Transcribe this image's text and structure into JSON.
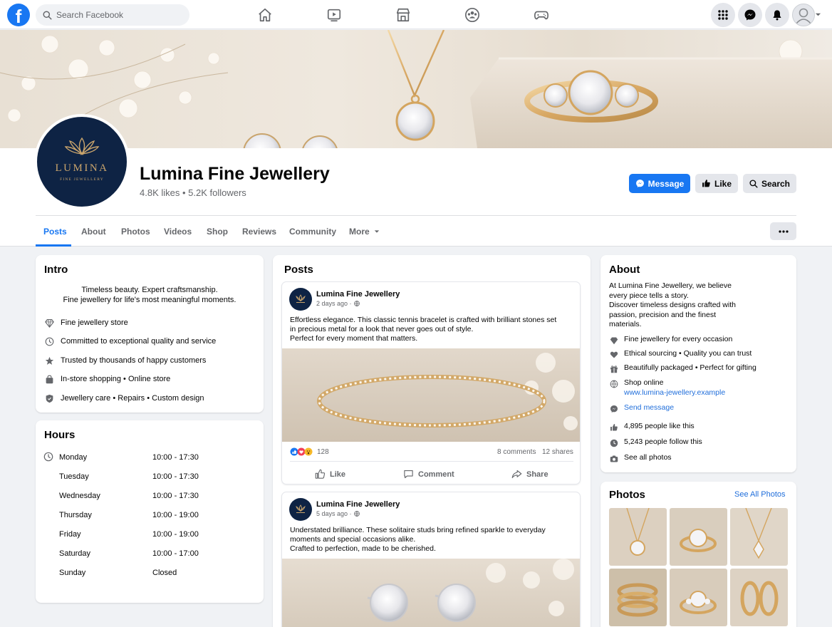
{
  "topbar": {
    "logo": "f",
    "search_placeholder": "Search Facebook",
    "nav_icons": [
      "home-icon",
      "watch-icon",
      "marketplace-icon",
      "groups-icon",
      "gaming-icon"
    ],
    "right_icons": [
      "menu-grid-icon",
      "messenger-icon",
      "notifications-icon",
      "account-avatar"
    ]
  },
  "page": {
    "name": "Lumina Fine Jewellery",
    "stats": "4.8K likes • 5.2K followers",
    "logo_text": "LUMINA",
    "logo_subtext": "FINE JEWELLERY",
    "buttons": {
      "message": "Message",
      "like": "Like",
      "search": "Search"
    },
    "accent": "#1877f2"
  },
  "tabs": [
    "Posts",
    "About",
    "Photos",
    "Videos",
    "Shop",
    "Reviews",
    "Community",
    "More"
  ],
  "intro": {
    "title": "Intro",
    "bio_line1": "Timeless beauty. Expert craftsmanship.",
    "bio_line2": "Fine jewellery for life's most meaningful moments.",
    "items": [
      {
        "icon": "diamond-icon",
        "text": "Fine jewellery store"
      },
      {
        "icon": "clock-icon",
        "text": "Committed to exceptional quality and service"
      },
      {
        "icon": "star-icon",
        "text": "Trusted by thousands of happy customers"
      },
      {
        "icon": "shopping-bag-icon",
        "text": "In-store shopping • Online store"
      },
      {
        "icon": "shield-icon",
        "text": "Jewellery care • Repairs • Custom design"
      }
    ]
  },
  "hours": {
    "title": "Hours",
    "rows": [
      {
        "day": "Monday",
        "time": "10:00 - 17:30"
      },
      {
        "day": "Tuesday",
        "time": "10:00 - 17:30"
      },
      {
        "day": "Wednesday",
        "time": "10:00 - 17:30"
      },
      {
        "day": "Thursday",
        "time": "10:00 - 19:00"
      },
      {
        "day": "Friday",
        "time": "10:00 - 19:00"
      },
      {
        "day": "Saturday",
        "time": "10:00 - 17:00"
      },
      {
        "day": "Sunday",
        "time": "Closed"
      }
    ]
  },
  "posts": {
    "title": "Posts",
    "items": [
      {
        "author": "Lumina Fine Jewellery",
        "time": "2 days ago ·",
        "line1": "Effortless elegance. This classic tennis bracelet is crafted with brilliant stones set",
        "line2": "in precious metal for a look that never goes out of style.",
        "line3": "Perfect for every moment that matters.",
        "reactions": "128",
        "comments": "8 comments",
        "shares": "12 shares"
      },
      {
        "author": "Lumina Fine Jewellery",
        "time": "5 days ago ·",
        "line1": "Understated brilliance. These solitaire studs bring refined sparkle to everyday",
        "line2": "moments and special occasions alike.",
        "line3": "Crafted to perfection, made to be cherished."
      }
    ],
    "actions": {
      "like": "Like",
      "comment": "Comment",
      "share": "Share"
    }
  },
  "about": {
    "title": "About",
    "desc_lines": [
      "At Lumina Fine Jewellery, we believe",
      "every piece tells a story.",
      "Discover timeless designs crafted with",
      "passion, precision and the finest",
      "materials."
    ],
    "items": [
      {
        "icon": "diamond-icon",
        "text": "Fine jewellery for every occasion"
      },
      {
        "icon": "heart-icon",
        "text": "Ethical sourcing • Quality you can trust"
      },
      {
        "icon": "gift-icon",
        "text": "Beautifully packaged • Perfect for gifting"
      }
    ],
    "shop_label": "Shop online",
    "website": "www.lumina-jewellery.example",
    "send_message": "Send message",
    "likes_text": "4,895 people like this",
    "follows_text": "5,243 people follow this",
    "see_photos": "See all photos"
  },
  "photos": {
    "title": "Photos",
    "see_all": "See All Photos"
  }
}
